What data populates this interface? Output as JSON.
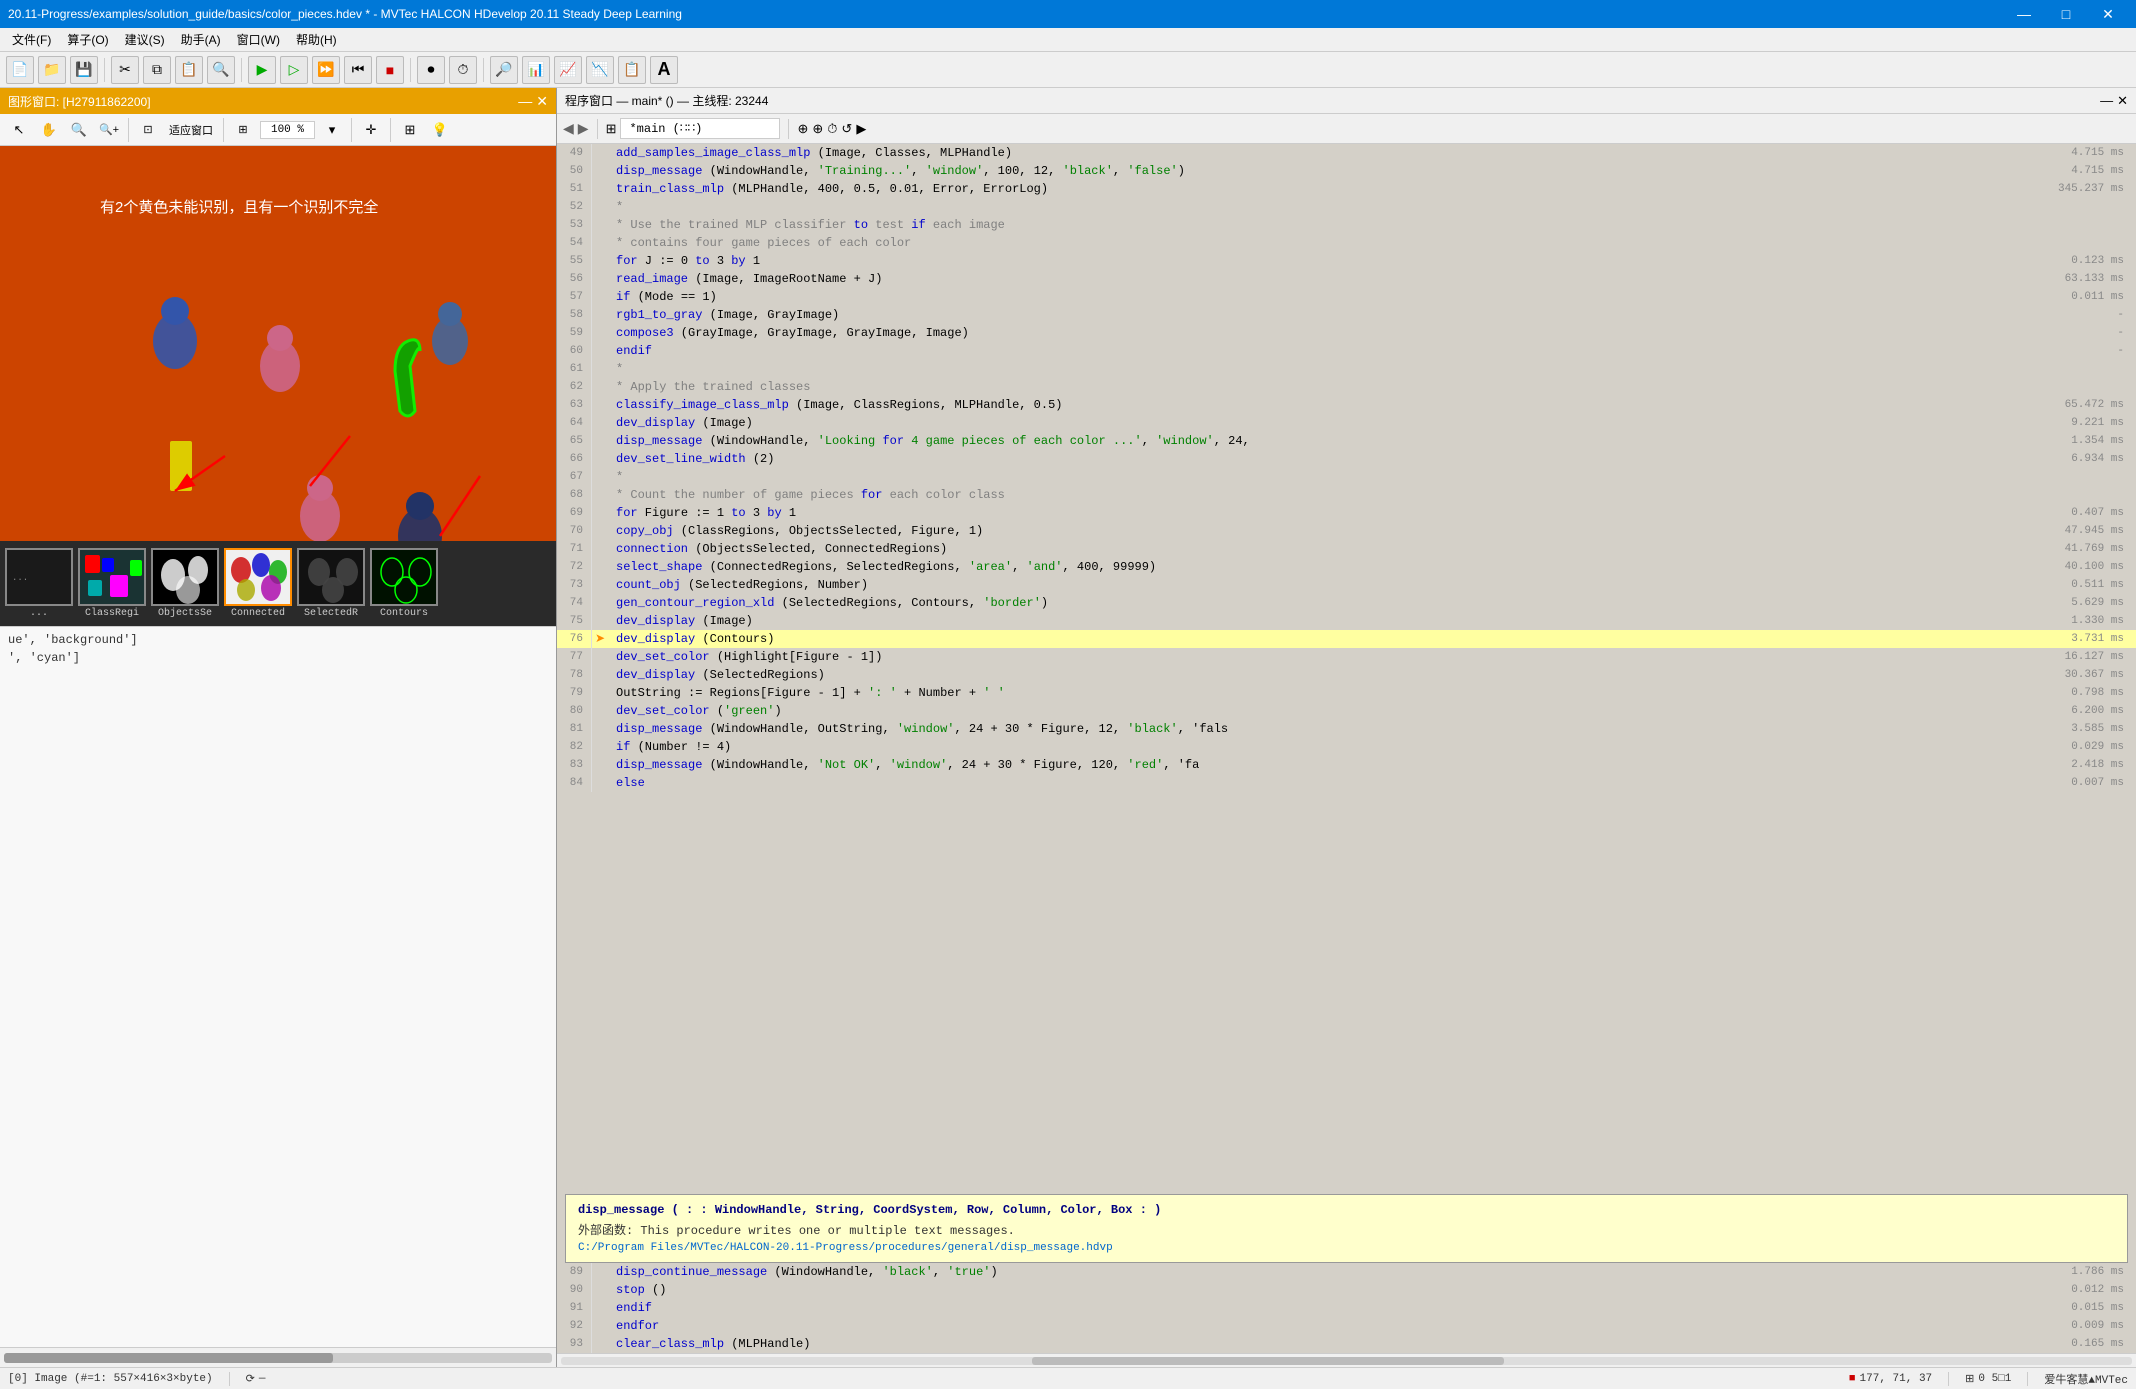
{
  "titlebar": {
    "title": "20.11-Progress/examples/solution_guide/basics/color_pieces.hdev * - MVTec HALCON HDevelop 20.11 Steady Deep Learning",
    "min": "—",
    "max": "□",
    "close": "✕"
  },
  "menubar": {
    "items": [
      "文件(F)",
      "算子(O)",
      "建议(S)",
      "助手(A)",
      "窗口(W)",
      "帮助(H)"
    ]
  },
  "toolbar": {
    "buttons": [
      "new",
      "open",
      "save",
      "cut",
      "copy",
      "paste",
      "undo",
      "run",
      "run-step",
      "stop",
      "rewind",
      "reset",
      "record",
      "search",
      "chart1",
      "chart2",
      "chart3",
      "chart4",
      "bigA"
    ]
  },
  "graphics_window": {
    "title": "图形窗口: [H27911862200]",
    "zoom_value": "100 %",
    "image_text": "有2个黄色未能识别，且有一个识别不完全"
  },
  "thumbnails": [
    {
      "label": "ClassRegi",
      "color": "#008080",
      "active": false
    },
    {
      "label": "ObjectsSe",
      "color": "#000000",
      "active": false
    },
    {
      "label": "Connected",
      "color": "#ffffff",
      "active": true
    },
    {
      "label": "SelectedR",
      "color": "#444444",
      "active": false
    },
    {
      "label": "Contours",
      "color": "#003300",
      "active": false
    }
  ],
  "code_editor": {
    "title": "程序窗口 — main* () — 主线程: 23244",
    "current_function": "*main (∷∷)",
    "lines": [
      {
        "num": 49,
        "arrow": false,
        "content": "    add_samples_image_class_mlp (Image, Classes, MLPHandle)",
        "time": "4.715 ms"
      },
      {
        "num": 50,
        "arrow": false,
        "content": "    disp_message (WindowHandle, 'Training...', 'window', 100, 12, 'black', 'false')",
        "time": "4.715 ms"
      },
      {
        "num": 51,
        "arrow": false,
        "content": "    train_class_mlp (MLPHandle, 400, 0.5, 0.01, Error, ErrorLog)",
        "time": "345.237 ms"
      },
      {
        "num": 52,
        "arrow": false,
        "content": "    *",
        "time": ""
      },
      {
        "num": 53,
        "arrow": false,
        "content": "    * Use the trained MLP classifier to test if each image",
        "time": ""
      },
      {
        "num": 54,
        "arrow": false,
        "content": "    * contains four game pieces of each color",
        "time": ""
      },
      {
        "num": 55,
        "arrow": false,
        "content": "    for J := 0 to 3 by 1",
        "time": "0.123 ms"
      },
      {
        "num": 56,
        "arrow": false,
        "content": "        read_image (Image, ImageRootName + J)",
        "time": "63.133 ms"
      },
      {
        "num": 57,
        "arrow": false,
        "content": "        if (Mode == 1)",
        "time": "0.011 ms"
      },
      {
        "num": 58,
        "arrow": false,
        "content": "            rgb1_to_gray (Image, GrayImage)",
        "time": "-"
      },
      {
        "num": 59,
        "arrow": false,
        "content": "            compose3 (GrayImage, GrayImage, GrayImage, Image)",
        "time": "-"
      },
      {
        "num": 60,
        "arrow": false,
        "content": "        endif",
        "time": "-"
      },
      {
        "num": 61,
        "arrow": false,
        "content": "        *",
        "time": ""
      },
      {
        "num": 62,
        "arrow": false,
        "content": "        * Apply the trained classes",
        "time": ""
      },
      {
        "num": 63,
        "arrow": false,
        "content": "        classify_image_class_mlp (Image, ClassRegions, MLPHandle, 0.5)",
        "time": "65.472 ms"
      },
      {
        "num": 64,
        "arrow": false,
        "content": "        dev_display (Image)",
        "time": "9.221 ms"
      },
      {
        "num": 65,
        "arrow": false,
        "content": "        disp_message (WindowHandle, 'Looking for 4 game pieces of each color ...', 'window', 24,",
        "time": "1.354 ms"
      },
      {
        "num": 66,
        "arrow": false,
        "content": "        dev_set_line_width (2)",
        "time": "6.934 ms"
      },
      {
        "num": 67,
        "arrow": false,
        "content": "        *",
        "time": ""
      },
      {
        "num": 68,
        "arrow": false,
        "content": "        * Count the number of game pieces for each color class",
        "time": ""
      },
      {
        "num": 69,
        "arrow": false,
        "content": "        for Figure := 1 to 3 by 1",
        "time": "0.407 ms"
      },
      {
        "num": 70,
        "arrow": false,
        "content": "            copy_obj (ClassRegions, ObjectsSelected, Figure, 1)",
        "time": "47.945 ms"
      },
      {
        "num": 71,
        "arrow": false,
        "content": "            connection (ObjectsSelected, ConnectedRegions)",
        "time": "41.769 ms"
      },
      {
        "num": 72,
        "arrow": false,
        "content": "            select_shape (ConnectedRegions, SelectedRegions, 'area', 'and', 400, 99999)",
        "time": "40.100 ms"
      },
      {
        "num": 73,
        "arrow": false,
        "content": "            count_obj (SelectedRegions, Number)",
        "time": "0.511 ms"
      },
      {
        "num": 74,
        "arrow": false,
        "content": "            gen_contour_region_xld (SelectedRegions, Contours, 'border')",
        "time": "5.629 ms"
      },
      {
        "num": 75,
        "arrow": false,
        "content": "            dev_display (Image)",
        "time": "1.330 ms"
      },
      {
        "num": 76,
        "arrow": true,
        "content": "            dev_display (Contours)",
        "time": "3.731 ms",
        "highlighted": true
      },
      {
        "num": 77,
        "arrow": false,
        "content": "            dev_set_color (Highlight[Figure - 1])",
        "time": "16.127 ms"
      },
      {
        "num": 78,
        "arrow": false,
        "content": "            dev_display (SelectedRegions)",
        "time": "30.367 ms"
      },
      {
        "num": 79,
        "arrow": false,
        "content": "            OutString := Regions[Figure - 1] + ': ' + Number + '   '",
        "time": "0.798 ms"
      },
      {
        "num": 80,
        "arrow": false,
        "content": "            dev_set_color ('green')",
        "time": "6.200 ms"
      },
      {
        "num": 81,
        "arrow": false,
        "content": "            disp_message (WindowHandle, OutString, 'window', 24 + 30 * Figure, 12, 'black', 'fals",
        "time": "3.585 ms"
      },
      {
        "num": 82,
        "arrow": false,
        "content": "            if (Number != 4)",
        "time": "0.029 ms"
      },
      {
        "num": 83,
        "arrow": false,
        "content": "                disp_message (WindowHandle, 'Not OK', 'window', 24 + 30 * Figure, 120, 'red', 'fa",
        "time": "2.418 ms"
      },
      {
        "num": 84,
        "arrow": false,
        "content": "        else",
        "time": "0.007 ms"
      }
    ],
    "tooltip": {
      "signature": "disp_message ( : : WindowHandle, String, CoordSystem, Row, Column, Color, Box : )",
      "desc": "外部函数:  This procedure writes one or multiple text messages.",
      "path": "C:/Program Files/MVTec/HALCON-20.11-Progress/procedures/general/disp_message.hdvp"
    },
    "lines_after_tooltip": [
      {
        "num": 89,
        "arrow": false,
        "content": "            disp_continue_message (WindowHandle, 'black', 'true')",
        "time": "1.786 ms"
      },
      {
        "num": 90,
        "arrow": false,
        "content": "            stop ()",
        "time": "0.012 ms"
      },
      {
        "num": 91,
        "arrow": false,
        "content": "            endif",
        "time": "0.015 ms"
      },
      {
        "num": 92,
        "arrow": false,
        "content": "        endfor",
        "time": "0.009 ms"
      },
      {
        "num": 93,
        "arrow": false,
        "content": "        clear_class_mlp (MLPHandle)",
        "time": "0.165 ms"
      }
    ]
  },
  "left_code": [
    {
      "content": "ue', 'background']"
    },
    {
      "content": "', 'cyan']"
    }
  ],
  "status_bar": {
    "image_info": "[0] Image (#=1: 557×416×3×byte)",
    "coords": "177, 71, 37",
    "zoom": "0 5□1",
    "brand": "爱牛客慧▲MVTec"
  }
}
